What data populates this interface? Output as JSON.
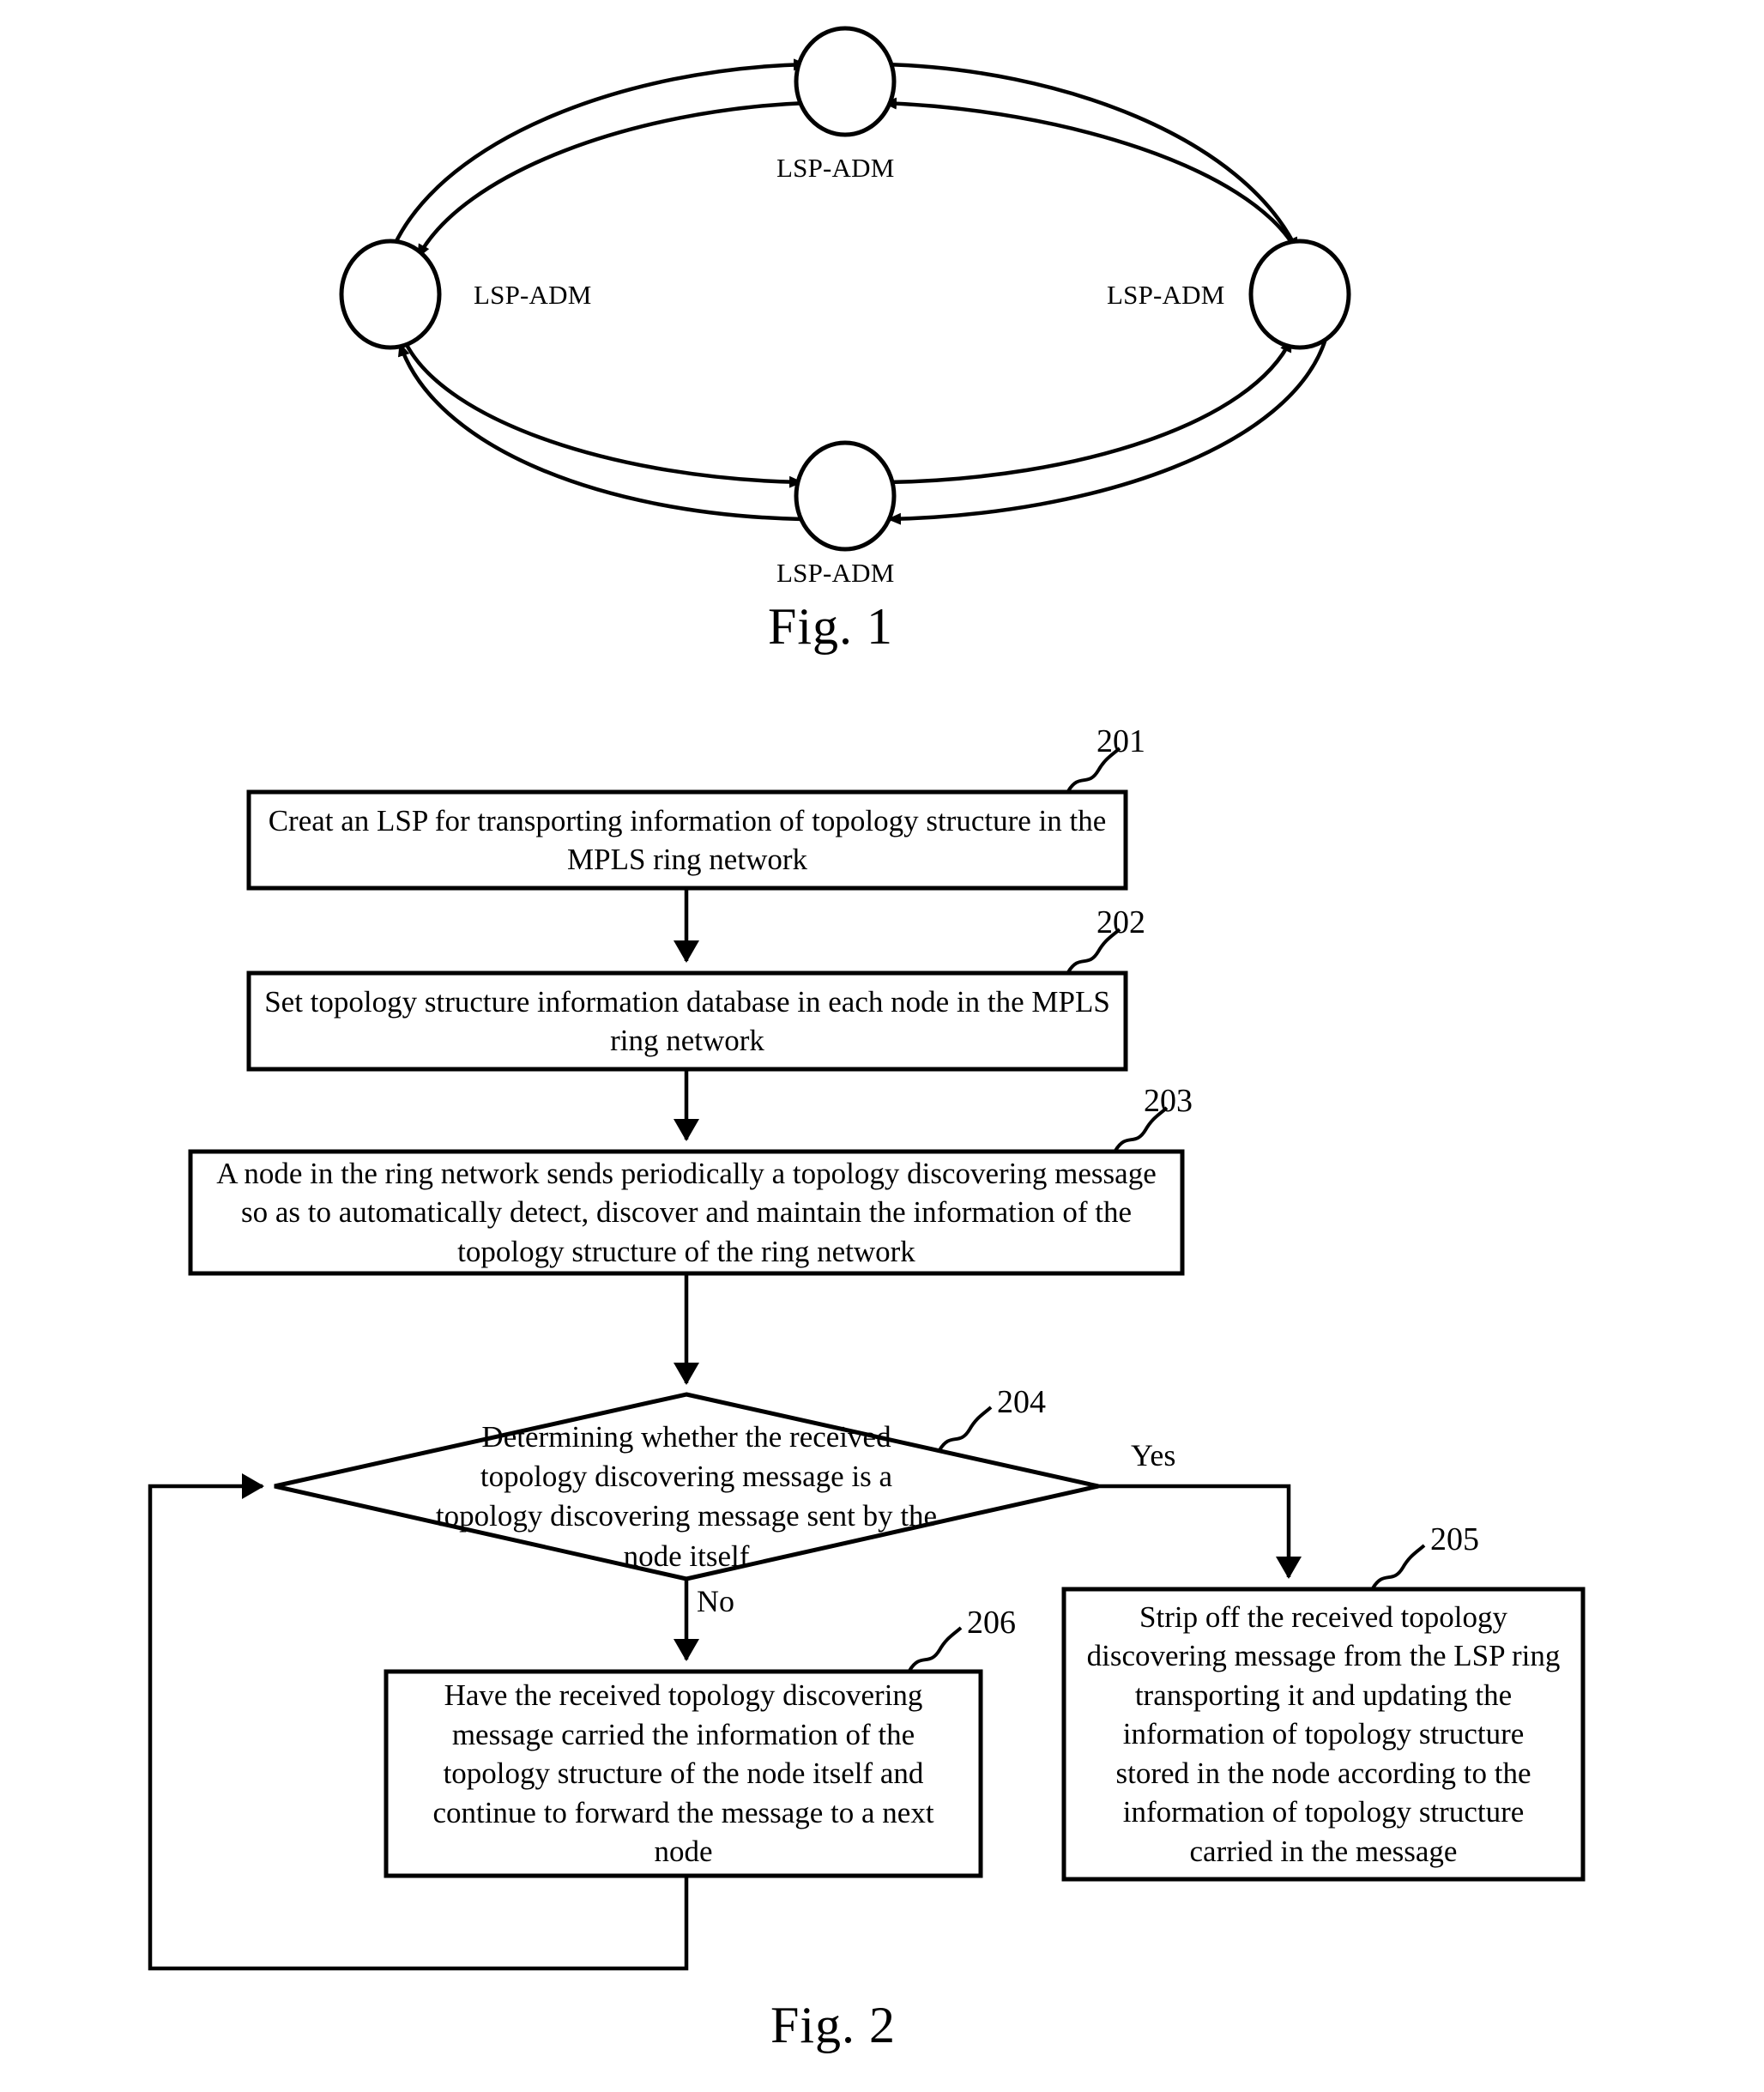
{
  "figure1": {
    "caption": "Fig. 1",
    "nodes": [
      {
        "id": "node-top",
        "label": "LSP-ADM"
      },
      {
        "id": "node-left",
        "label": "LSP-ADM"
      },
      {
        "id": "node-right",
        "label": "LSP-ADM"
      },
      {
        "id": "node-bottom",
        "label": "LSP-ADM"
      }
    ],
    "ring_description": "MPLS ring network with two counter-rotating LSP rings connecting four LSP-ADM nodes"
  },
  "figure2": {
    "caption": "Fig. 2",
    "steps": [
      {
        "ref": "201",
        "shape": "process",
        "text": "Creat an LSP for transporting information of topology structure in the MPLS ring network"
      },
      {
        "ref": "202",
        "shape": "process",
        "text": "Set topology structure information database in each node in the MPLS ring network"
      },
      {
        "ref": "203",
        "shape": "process",
        "text": "A node in the ring network sends periodically a topology discovering message so as to automatically detect, discover and maintain the information of the topology structure of the ring network"
      },
      {
        "ref": "204",
        "shape": "decision",
        "text": "Determining whether the received topology discovering message is a topology discovering message sent by the node itself"
      },
      {
        "ref": "205",
        "shape": "process",
        "text": "Strip off the received topology discovering message from the LSP ring transporting it and updating the information of topology structure stored in the node according to the information of topology structure carried in the message"
      },
      {
        "ref": "206",
        "shape": "process",
        "text": "Have the received topology discovering message carried the information of the topology structure of the node itself and continue to forward the message to a next node"
      }
    ],
    "branch_labels": {
      "yes": "Yes",
      "no": "No"
    }
  },
  "colors": {
    "ink": "#000000",
    "page": "#ffffff"
  }
}
